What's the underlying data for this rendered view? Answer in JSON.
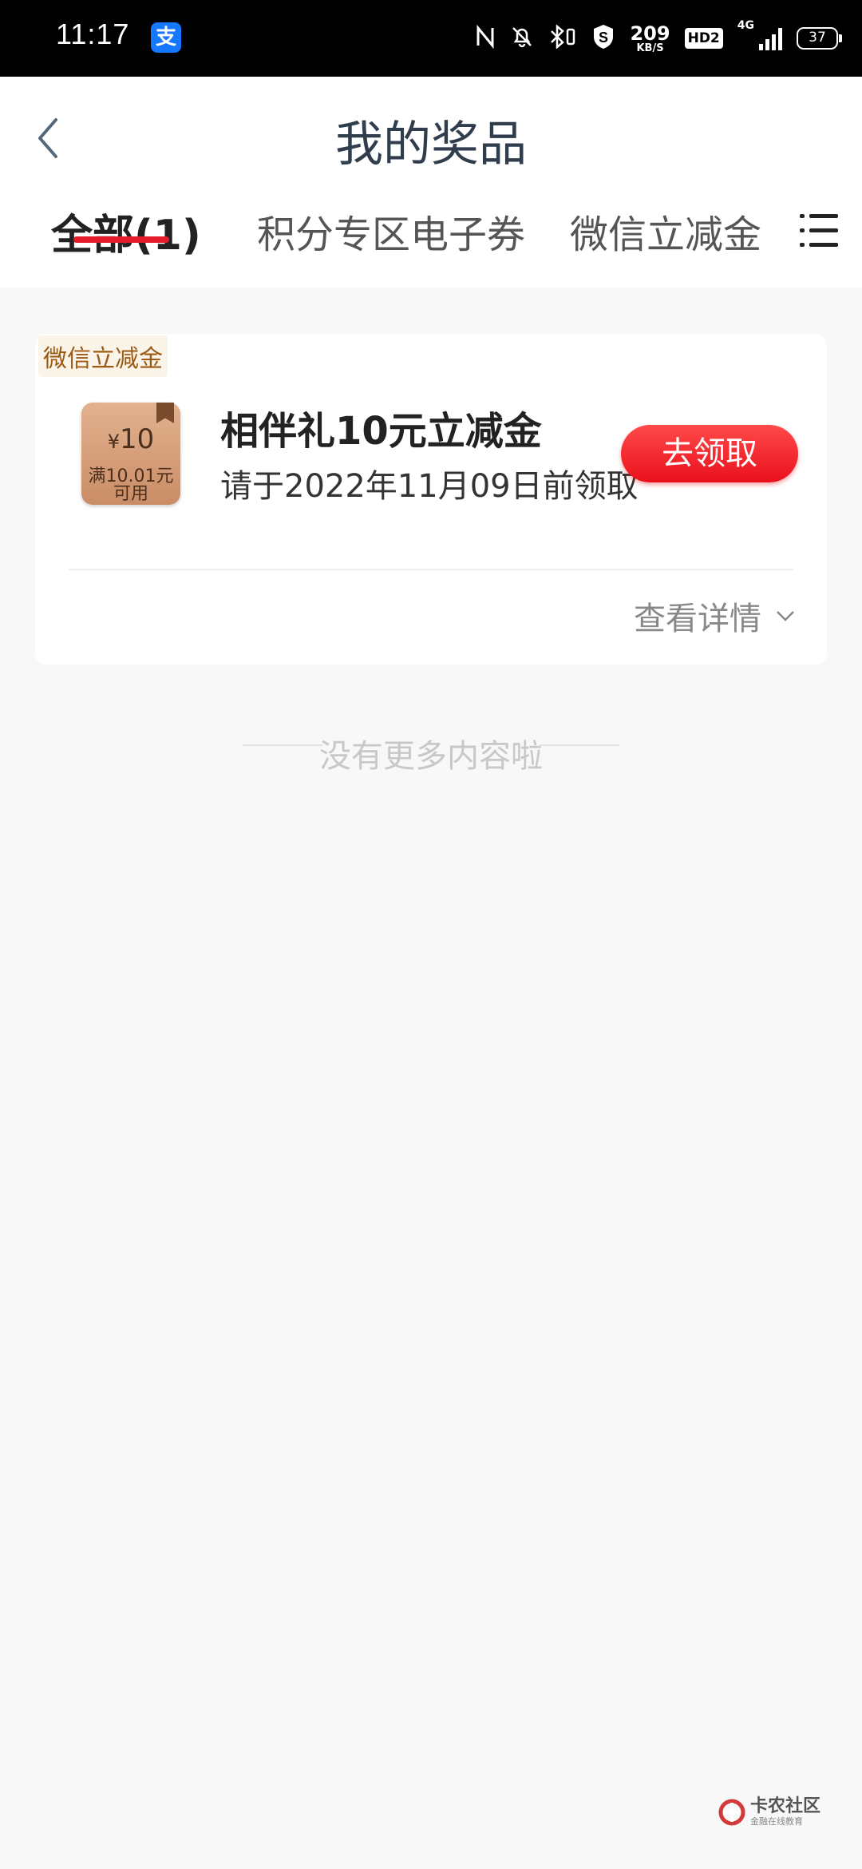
{
  "status_bar": {
    "time": "11:17",
    "app_icon_glyph": "支",
    "net_speed_value": "209",
    "net_speed_unit": "KB/S",
    "hd_label": "HD2",
    "network_type": "4G",
    "battery": "37"
  },
  "header": {
    "title": "我的奖品"
  },
  "tabs": [
    {
      "label": "全部(1)",
      "active": true
    },
    {
      "label": "积分专区电子券",
      "active": false
    },
    {
      "label": "微信立减金",
      "active": false
    }
  ],
  "prize_card": {
    "tag": "微信立减金",
    "coupon_currency": "¥",
    "coupon_amount": "10",
    "coupon_condition_1": "满10.01元",
    "coupon_condition_2": "可用",
    "title": "相伴礼10元立减金",
    "deadline": "请于2022年11月09日前领取",
    "claim_button": "去领取",
    "details_link": "查看详情"
  },
  "list_end_text": "没有更多内容啦",
  "watermark": {
    "name": "卡农社区",
    "tagline": "金融在线教育"
  },
  "colors": {
    "accent_red": "#e31b2b",
    "title_color": "#2f3d4c",
    "tag_brown": "#9a5a14",
    "page_bg": "#f8f8f8"
  }
}
